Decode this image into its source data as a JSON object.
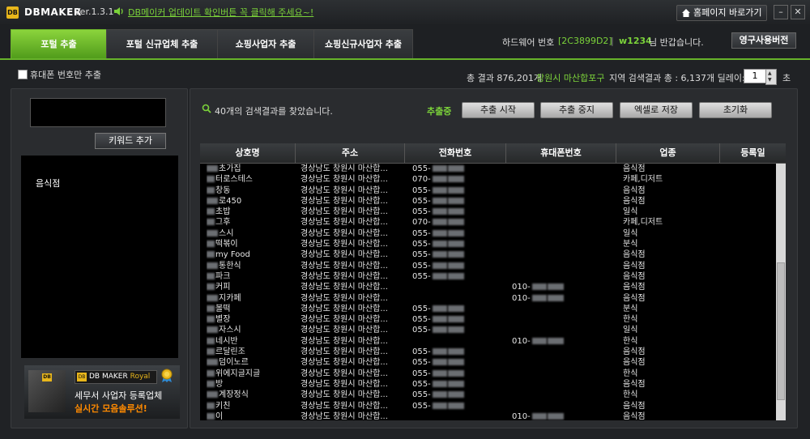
{
  "titlebar": {
    "logo": "DB",
    "app_name": "DBMAKER",
    "version": "Ver.1.3.1",
    "notice": "DB메이커 업데이트 확인버튼 꼭 클릭해 주세요~!",
    "home_button": "홈페이지 바로가기",
    "minimize": "–",
    "close": "✕"
  },
  "tabs": [
    {
      "label": "포털 추출",
      "active": true
    },
    {
      "label": "포털 신규업체 추출",
      "active": false
    },
    {
      "label": "쇼핑사업자 추출",
      "active": false
    },
    {
      "label": "쇼핑신규사업자 추출",
      "active": false
    }
  ],
  "account": {
    "hw_label": "하드웨어 번호",
    "hw_value": "[2C3899D2]",
    "separator": "|",
    "user_id": "w1234",
    "greeting": "님 반갑습니다.",
    "license_button": "영구사용버전"
  },
  "status": {
    "phone_only_label": "휴대폰 번호만 추출",
    "total_prefix": "총 결과 876,201개",
    "region": "창원시 마산합포구",
    "region_suffix": "지역 검색결과 총 : 6,137개 딜레이:",
    "delay_value": "1",
    "delay_unit": "초"
  },
  "left": {
    "keyword_input_value": "",
    "keyword_add_button": "키워드 추가",
    "keywords": [
      "음식점"
    ],
    "ad": {
      "box_logo": "DB",
      "logo_text": "DB MAKER",
      "logo_royal": "Royal",
      "line1": "세무서 사업자 등록업체",
      "line2": "실시간 모음솔루션!"
    }
  },
  "right": {
    "found_text": "40개의 검색결과를 찾았습니다.",
    "extracting": "추출중",
    "buttons": {
      "start": "추출 시작",
      "stop": "추출 중지",
      "excel": "엑셀로 저장",
      "reset": "초기화"
    },
    "columns": [
      "상호명",
      "주소",
      "전화번호",
      "휴대폰번호",
      "업종",
      "등록일"
    ],
    "rows": [
      {
        "name": "초가집",
        "address": "경상남도 창원시 마산합...",
        "phone": "055-",
        "mobile": "",
        "category": "음식점",
        "date": ""
      },
      {
        "name": "터로스테스",
        "address": "경상남도 창원시 마산합...",
        "phone": "070-",
        "mobile": "",
        "category": "카페,디저트",
        "date": ""
      },
      {
        "name": "창동",
        "address": "경상남도 창원시 마산합...",
        "phone": "055-",
        "mobile": "",
        "category": "음식점",
        "date": ""
      },
      {
        "name": "로450",
        "address": "경상남도 창원시 마산합...",
        "phone": "055-",
        "mobile": "",
        "category": "음식점",
        "date": ""
      },
      {
        "name": "초밥",
        "address": "경상남도 창원시 마산합...",
        "phone": "055-",
        "mobile": "",
        "category": "일식",
        "date": ""
      },
      {
        "name": "그후",
        "address": "경상남도 창원시 마산합...",
        "phone": "070-",
        "mobile": "",
        "category": "카페,디저트",
        "date": ""
      },
      {
        "name": "스시",
        "address": "경상남도 창원시 마산합...",
        "phone": "055-",
        "mobile": "",
        "category": "일식",
        "date": ""
      },
      {
        "name": "떡볶이",
        "address": "경상남도 창원시 마산합...",
        "phone": "055-",
        "mobile": "",
        "category": "분식",
        "date": ""
      },
      {
        "name": "my Food",
        "address": "경상남도 창원시 마산합...",
        "phone": "055-",
        "mobile": "",
        "category": "음식점",
        "date": ""
      },
      {
        "name": "통한식",
        "address": "경상남도 창원시 마산합...",
        "phone": "055-",
        "mobile": "",
        "category": "음식점",
        "date": ""
      },
      {
        "name": "파크",
        "address": "경상남도 창원시 마산합...",
        "phone": "055-",
        "mobile": "",
        "category": "음식점",
        "date": ""
      },
      {
        "name": "커피",
        "address": "경상남도 창원시 마산합...",
        "phone": "",
        "mobile": "010-",
        "category": "음식점",
        "date": ""
      },
      {
        "name": "지카페",
        "address": "경상남도 창원시 마산합...",
        "phone": "",
        "mobile": "010-",
        "category": "음식점",
        "date": ""
      },
      {
        "name": "볼떡",
        "address": "경상남도 창원시 마산합...",
        "phone": "055-",
        "mobile": "",
        "category": "분식",
        "date": ""
      },
      {
        "name": "별장",
        "address": "경상남도 창원시 마산합...",
        "phone": "055-",
        "mobile": "",
        "category": "한식",
        "date": ""
      },
      {
        "name": "자스시",
        "address": "경상남도 창원시 마산합...",
        "phone": "055-",
        "mobile": "",
        "category": "일식",
        "date": ""
      },
      {
        "name": "네시반",
        "address": "경상남도 창원시 마산합...",
        "phone": "",
        "mobile": "010-",
        "category": "한식",
        "date": ""
      },
      {
        "name": "르달린조",
        "address": "경상남도 창원시 마산합...",
        "phone": "055-",
        "mobile": "",
        "category": "음식점",
        "date": ""
      },
      {
        "name": "덤이노르",
        "address": "경상남도 창원시 마산합...",
        "phone": "055-",
        "mobile": "",
        "category": "음식점",
        "date": ""
      },
      {
        "name": "위에지글지글",
        "address": "경상남도 창원시 마산합...",
        "phone": "055-",
        "mobile": "",
        "category": "한식",
        "date": ""
      },
      {
        "name": "방",
        "address": "경상남도 창원시 마산합...",
        "phone": "055-",
        "mobile": "",
        "category": "음식점",
        "date": ""
      },
      {
        "name": "계장정식",
        "address": "경상남도 창원시 마산합...",
        "phone": "055-",
        "mobile": "",
        "category": "한식",
        "date": ""
      },
      {
        "name": "키친",
        "address": "경상남도 창원시 마산합...",
        "phone": "055-",
        "mobile": "",
        "category": "음식점",
        "date": ""
      },
      {
        "name": "이",
        "address": "경상남도 창원시 마산합...",
        "phone": "",
        "mobile": "010-",
        "category": "음식점",
        "date": ""
      }
    ]
  }
}
